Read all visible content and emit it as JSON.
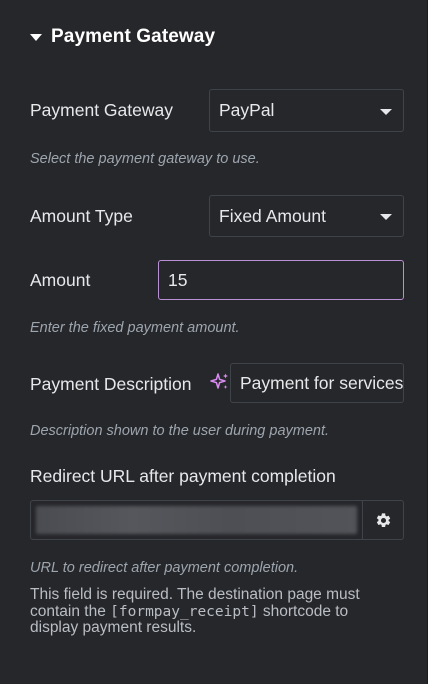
{
  "section": {
    "title": "Payment Gateway"
  },
  "gateway": {
    "label": "Payment Gateway",
    "value": "PayPal",
    "hint": "Select the payment gateway to use."
  },
  "amount_type": {
    "label": "Amount Type",
    "value": "Fixed Amount"
  },
  "amount": {
    "label": "Amount",
    "value": "15",
    "hint": "Enter the fixed payment amount."
  },
  "description": {
    "label": "Payment Description",
    "value": "Payment for services",
    "hint": "Description shown to the user during payment."
  },
  "redirect": {
    "label": "Redirect URL after payment completion",
    "hint": "URL to redirect after payment completion.",
    "note_before": "This field is required. The destination page must contain the ",
    "shortcode": "[formpay_receipt]",
    "note_after": " shortcode to display payment results."
  },
  "colors": {
    "background": "#26272b",
    "border": "#3f444b",
    "focus_border": "#b98fd6",
    "ai_icon": "#d98cf0",
    "hint_text": "#9da5ae"
  },
  "icons": {
    "section_toggle": "caret-down-icon",
    "ai": "ai-sparkle-icon",
    "settings": "gear-icon"
  }
}
